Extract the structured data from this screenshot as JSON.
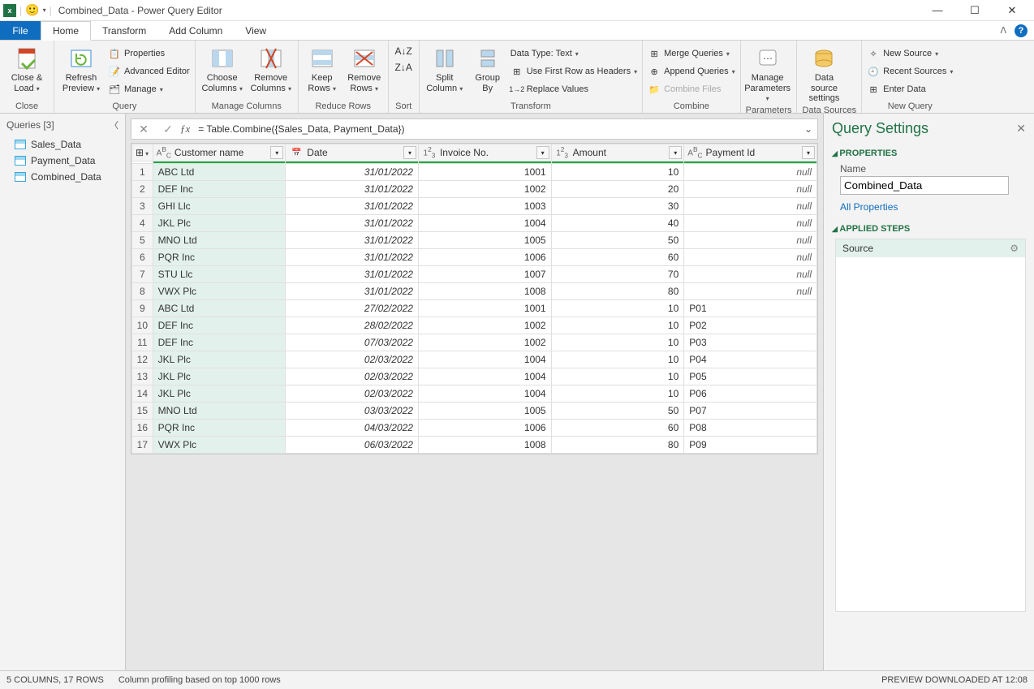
{
  "window": {
    "title": "Combined_Data - Power Query Editor"
  },
  "ribbon": {
    "tabs": {
      "file": "File",
      "home": "Home",
      "transform": "Transform",
      "addcol": "Add Column",
      "view": "View"
    },
    "groups": {
      "close": "Close",
      "query": "Query",
      "managecols": "Manage Columns",
      "reducerows": "Reduce Rows",
      "sort": "Sort",
      "transform": "Transform",
      "combine": "Combine",
      "parameters": "Parameters",
      "datasources": "Data Sources",
      "newquery": "New Query"
    },
    "btns": {
      "closeload": "Close &\nLoad",
      "refresh": "Refresh\nPreview",
      "properties": "Properties",
      "adveditor": "Advanced Editor",
      "manage": "Manage",
      "choosecols": "Choose\nColumns",
      "removecols": "Remove\nColumns",
      "keeprows": "Keep\nRows",
      "removerows": "Remove\nRows",
      "split": "Split\nColumn",
      "groupby": "Group\nBy",
      "datatype": "Data Type: Text",
      "firstrow": "Use First Row as Headers",
      "replace": "Replace Values",
      "merge": "Merge Queries",
      "append": "Append Queries",
      "combinefiles": "Combine Files",
      "manageparams": "Manage\nParameters",
      "datasource": "Data source\nsettings",
      "newsource": "New Source",
      "recent": "Recent Sources",
      "enterdata": "Enter Data"
    }
  },
  "queriesPane": {
    "header": "Queries [3]",
    "items": [
      "Sales_Data",
      "Payment_Data",
      "Combined_Data"
    ]
  },
  "formula": "= Table.Combine({Sales_Data, Payment_Data})",
  "columns": [
    "Customer name",
    "Date",
    "Invoice No.",
    "Amount",
    "Payment Id"
  ],
  "rows": [
    {
      "n": 1,
      "c": "ABC Ltd",
      "d": "31/01/2022",
      "inv": "1001",
      "amt": "10",
      "pid": null
    },
    {
      "n": 2,
      "c": "DEF Inc",
      "d": "31/01/2022",
      "inv": "1002",
      "amt": "20",
      "pid": null
    },
    {
      "n": 3,
      "c": "GHI Llc",
      "d": "31/01/2022",
      "inv": "1003",
      "amt": "30",
      "pid": null
    },
    {
      "n": 4,
      "c": "JKL Plc",
      "d": "31/01/2022",
      "inv": "1004",
      "amt": "40",
      "pid": null
    },
    {
      "n": 5,
      "c": "MNO Ltd",
      "d": "31/01/2022",
      "inv": "1005",
      "amt": "50",
      "pid": null
    },
    {
      "n": 6,
      "c": "PQR Inc",
      "d": "31/01/2022",
      "inv": "1006",
      "amt": "60",
      "pid": null
    },
    {
      "n": 7,
      "c": "STU Llc",
      "d": "31/01/2022",
      "inv": "1007",
      "amt": "70",
      "pid": null
    },
    {
      "n": 8,
      "c": "VWX Plc",
      "d": "31/01/2022",
      "inv": "1008",
      "amt": "80",
      "pid": null
    },
    {
      "n": 9,
      "c": "ABC Ltd",
      "d": "27/02/2022",
      "inv": "1001",
      "amt": "10",
      "pid": "P01"
    },
    {
      "n": 10,
      "c": "DEF Inc",
      "d": "28/02/2022",
      "inv": "1002",
      "amt": "10",
      "pid": "P02"
    },
    {
      "n": 11,
      "c": "DEF Inc",
      "d": "07/03/2022",
      "inv": "1002",
      "amt": "10",
      "pid": "P03"
    },
    {
      "n": 12,
      "c": "JKL Plc",
      "d": "02/03/2022",
      "inv": "1004",
      "amt": "10",
      "pid": "P04"
    },
    {
      "n": 13,
      "c": "JKL Plc",
      "d": "02/03/2022",
      "inv": "1004",
      "amt": "10",
      "pid": "P05"
    },
    {
      "n": 14,
      "c": "JKL Plc",
      "d": "02/03/2022",
      "inv": "1004",
      "amt": "10",
      "pid": "P06"
    },
    {
      "n": 15,
      "c": "MNO Ltd",
      "d": "03/03/2022",
      "inv": "1005",
      "amt": "50",
      "pid": "P07"
    },
    {
      "n": 16,
      "c": "PQR Inc",
      "d": "04/03/2022",
      "inv": "1006",
      "amt": "60",
      "pid": "P08"
    },
    {
      "n": 17,
      "c": "VWX Plc",
      "d": "06/03/2022",
      "inv": "1008",
      "amt": "80",
      "pid": "P09"
    }
  ],
  "settings": {
    "title": "Query Settings",
    "props": "PROPERTIES",
    "nameLabel": "Name",
    "nameValue": "Combined_Data",
    "allProps": "All Properties",
    "applied": "APPLIED STEPS",
    "step1": "Source"
  },
  "status": {
    "left1": "5 COLUMNS, 17 ROWS",
    "left2": "Column profiling based on top 1000 rows",
    "right": "PREVIEW DOWNLOADED AT 12:08"
  }
}
